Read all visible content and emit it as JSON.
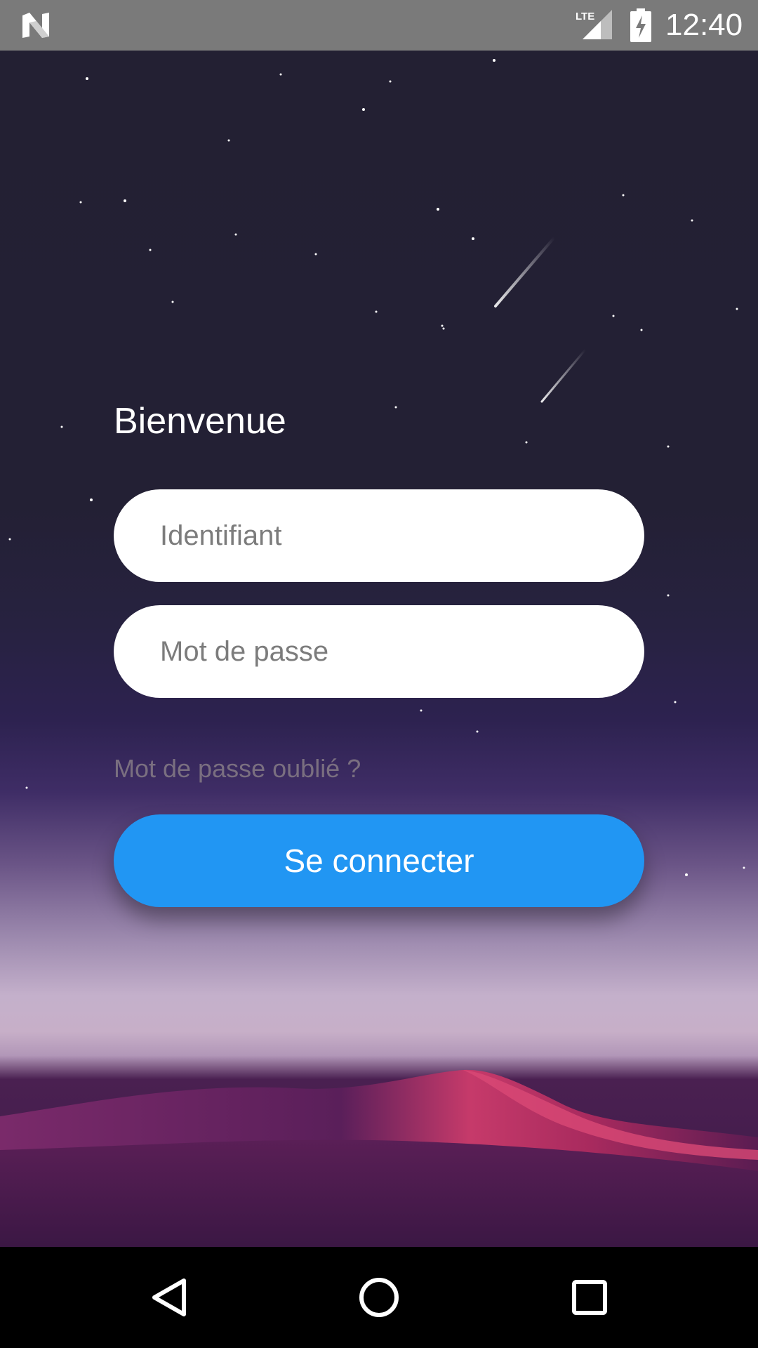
{
  "status_bar": {
    "network": "LTE",
    "time": "12:40"
  },
  "login": {
    "title": "Bienvenue",
    "username_placeholder": "Identifiant",
    "password_placeholder": "Mot de passe",
    "forgot_password": "Mot de passe oublié ?",
    "submit_label": "Se connecter"
  },
  "colors": {
    "primary_button": "#2196f3",
    "field_background": "#ffffff",
    "night_sky": "#232033"
  },
  "nav_bar": {
    "back_icon": "triangle-back",
    "home_icon": "circle-home",
    "recent_icon": "square-recent"
  }
}
